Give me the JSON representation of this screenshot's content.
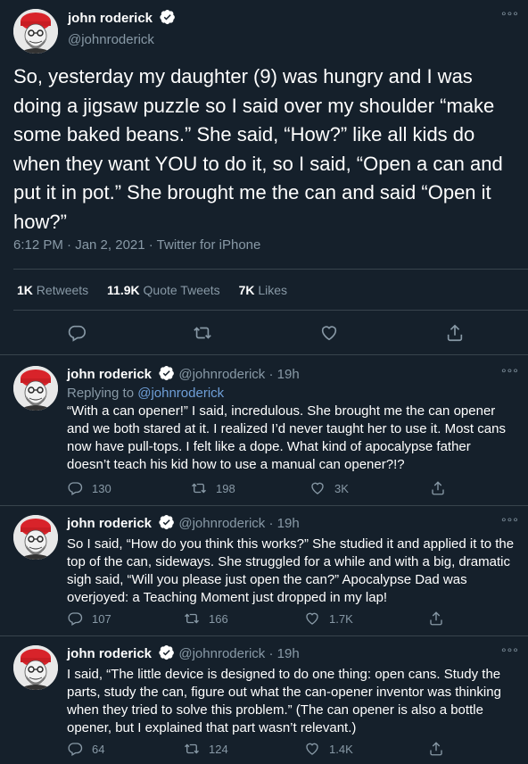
{
  "main_tweet": {
    "author_name": "john roderick",
    "handle": "@johnroderick",
    "more": "°°°",
    "text": "So, yesterday my daughter (9) was hungry and I was doing a jigsaw puzzle so I said over my shoulder “make some baked beans.” She said, “How?” like all kids do when they want YOU to do it, so I said, “Open a can and put it in pot.” She brought me the can and said “Open it how?”",
    "timestamp": "6:12 PM · Jan 2, 2021 · Twitter for iPhone",
    "stats": {
      "retweets_count": "1K",
      "retweets_label": "Retweets",
      "quotes_count": "11.9K",
      "quotes_label": "Quote Tweets",
      "likes_count": "7K",
      "likes_label": "Likes"
    },
    "icons": [
      "reply-icon",
      "retweet-icon",
      "like-icon",
      "share-icon"
    ]
  },
  "replies": [
    {
      "author_name": "john roderick",
      "handle_time": "@johnroderick · 19h",
      "more": "°°°",
      "replying_prefix": "Replying to ",
      "replying_handle": "@johnroderick",
      "text": "“With a can opener!” I said, incredulous. She brought me the can opener and we both stared at it. I realized I’d never taught her to use it. Most cans now have pull-tops. I felt like a dope. What kind of apocalypse father doesn’t teach his kid how to use a manual can opener?!?",
      "replies": "130",
      "retweets": "198",
      "likes": "3K"
    },
    {
      "author_name": "john roderick",
      "handle_time": "@johnroderick · 19h",
      "more": "°°°",
      "text": "So I said, “How do you think this works?” She studied it and applied it to the top of the can, sideways. She struggled for a while and with a big, dramatic sigh said, “Will you please just open the can?” Apocalypse Dad was overjoyed: a Teaching Moment just dropped in my lap!",
      "replies": "107",
      "retweets": "166",
      "likes": "1.7K"
    },
    {
      "author_name": "john roderick",
      "handle_time": "@johnroderick · 19h",
      "more": "°°°",
      "text": "I said, “The little device is designed to do one thing: open cans. Study the parts, study the can, figure out what the can-opener inventor was thinking when they tried to solve this problem.” (The can opener is also a bottle opener, but I explained that part wasn’t relevant.)",
      "replies": "64",
      "retweets": "124",
      "likes": "1.4K"
    }
  ],
  "colors": {
    "background": "#15202b",
    "text": "#ffffff",
    "muted": "#8899a6",
    "divider": "#38444d",
    "link": "#6f9fd8",
    "verified": "#ffffff"
  }
}
